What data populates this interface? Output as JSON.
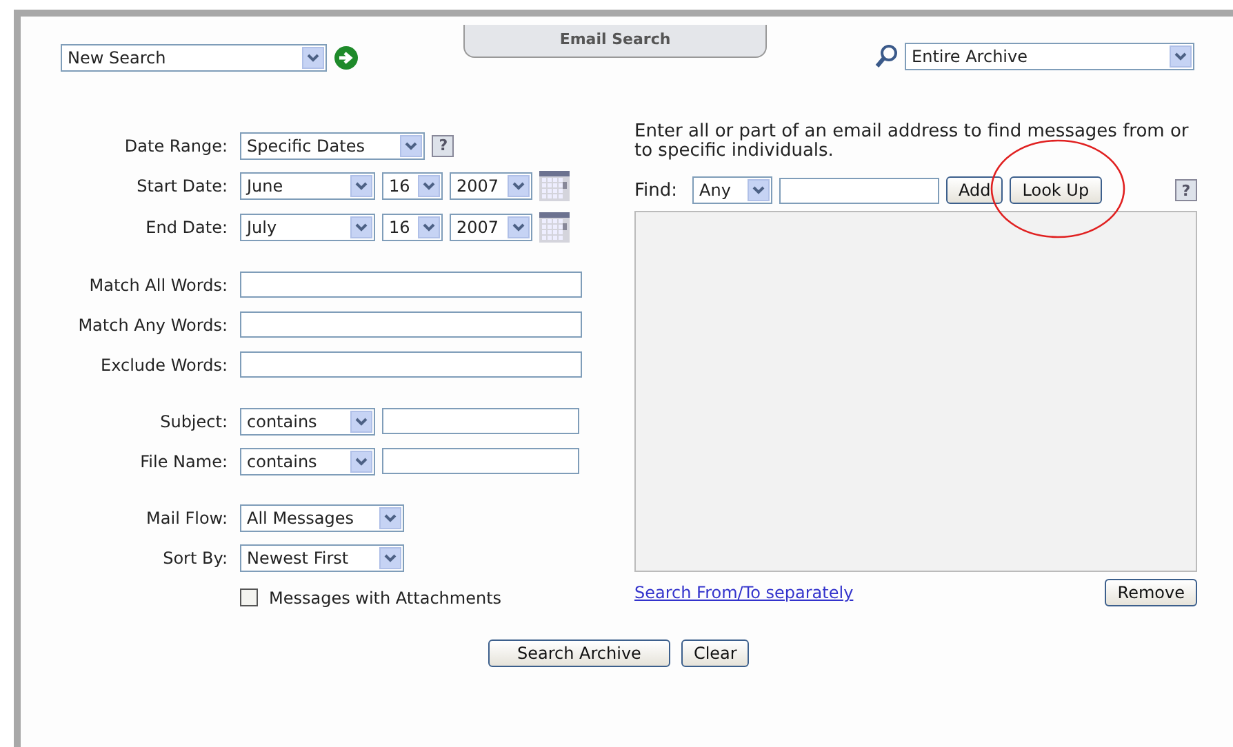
{
  "top_bar": {
    "search_type": {
      "value": "New Search"
    },
    "tab": {
      "label": "Email Search"
    },
    "scope": {
      "value": "Entire Archive"
    }
  },
  "form_groups": [
    [
      {
        "kind": "select",
        "label": "Date Range:",
        "value": "Specific Dates",
        "help": "?"
      },
      {
        "kind": "date",
        "label": "Start Date:",
        "month": "June",
        "day": "16",
        "year": "2007"
      },
      {
        "kind": "date",
        "label": "End Date:",
        "month": "July",
        "day": "16",
        "year": "2007"
      }
    ],
    [
      {
        "kind": "text",
        "label": "Match All Words:"
      },
      {
        "kind": "text",
        "label": "Match Any Words:"
      },
      {
        "kind": "text",
        "label": "Exclude Words:"
      }
    ],
    [
      {
        "kind": "select_text",
        "label": "Subject:",
        "value": "contains"
      },
      {
        "kind": "select_text",
        "label": "File Name:",
        "value": "contains"
      }
    ],
    [
      {
        "kind": "select",
        "label": "Mail Flow:",
        "value": "All Messages"
      },
      {
        "kind": "select",
        "label": "Sort By:",
        "value": "Newest First"
      },
      {
        "kind": "checkbox",
        "label": "Messages with Attachments",
        "checked": false
      }
    ]
  ],
  "address_panel": {
    "instructions": "Enter all or part of an email address to find messages from or to specific individuals.",
    "find_label": "Find:",
    "find_type": "Any",
    "add_button": "Add",
    "lookup_button": "Look Up",
    "help": "?",
    "link": "Search From/To separately",
    "remove_button": "Remove"
  },
  "actions": [
    "Search Archive",
    "Clear"
  ]
}
